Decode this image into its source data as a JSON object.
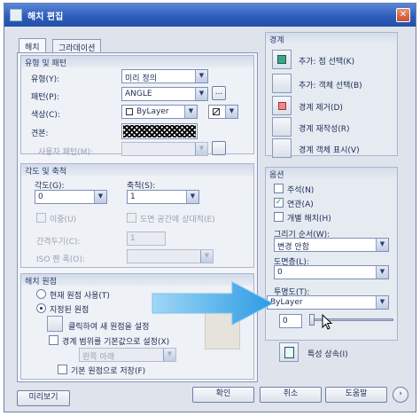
{
  "window": {
    "title": "해치 편집",
    "close_glyph": "✕"
  },
  "tabs": [
    "해치",
    "그라데이션"
  ],
  "type_pattern": {
    "header": "유형 및 패턴",
    "type_label": "유형(Y):",
    "type_value": "미리 정의",
    "pattern_label": "패턴(P):",
    "pattern_value": "ANGLE",
    "pattern_browse": "...",
    "color_label": "색상(C):",
    "color_value": "ByLayer",
    "color2_value": "",
    "swatch_label": "견본:",
    "custom_label": "사용자 패턴(M):"
  },
  "angle_scale": {
    "header": "각도 및 축척",
    "angle_label": "각도(G):",
    "angle_value": "0",
    "scale_label": "축척(S):",
    "scale_value": "1",
    "double_label": "이중(U)",
    "paper_label": "도면 공간에 상대적(E)",
    "spacing_label": "간격두기(C):",
    "spacing_value": "1",
    "iso_label": "ISO 펜 폭(O):"
  },
  "origin": {
    "header": "해치 원점",
    "current_label": "현재 원점 사용(T)",
    "specified_label": "지정된 원점",
    "click_label": "클릭하여 새 원점을 설정",
    "boundary_label": "경계 범위를 기본값으로 설정(X)",
    "position_value": "왼쪽 아래",
    "store_label": "기본 원점으로 저장(F)"
  },
  "boundaries": {
    "header": "경계",
    "add_pick": "추가: 점 선택(K)",
    "add_select": "추가: 객체 선택(B)",
    "remove": "경계 제거(D)",
    "recreate": "경계 재작성(R)",
    "view": "경계 객체 표시(V)"
  },
  "options": {
    "header": "옵션",
    "annotative": "주석(N)",
    "associative": "연관(A)",
    "separate": "개별 해치(H)",
    "draw_order_label": "그리기 순서(W):",
    "draw_order_value": "변경 안함",
    "layer_label": "도면층(L):",
    "layer_value": "0",
    "transparency_label": "투명도(T):",
    "transparency_value": "ByLayer",
    "transparency_amount": "0",
    "transparency_level": 0
  },
  "inherit": "특성 상속(I)",
  "buttons": {
    "preview": "미리보기",
    "ok": "확인",
    "cancel": "취소",
    "help": "도움말",
    "more": "›"
  },
  "check_glyph": "✓",
  "arrow_glyph": "▼",
  "colors": {
    "arrow": "#3aa3e8",
    "title": "#2c5ab8"
  }
}
